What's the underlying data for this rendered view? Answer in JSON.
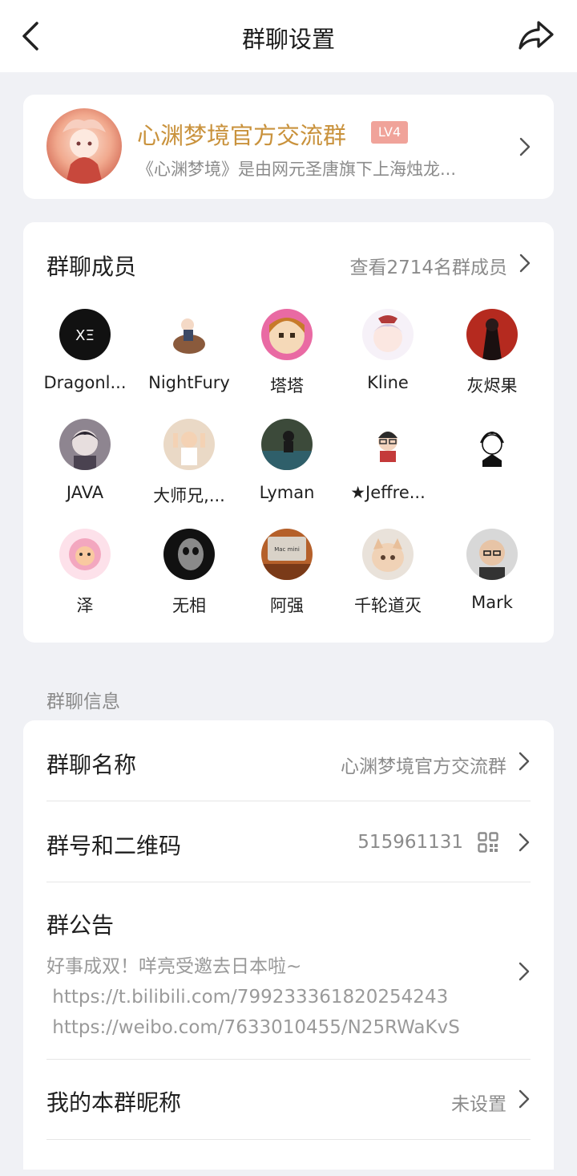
{
  "header": {
    "title": "群聊设置",
    "back_icon": "back-arrow-icon",
    "share_icon": "share-icon"
  },
  "group": {
    "name": "心渊梦境官方交流群",
    "level": "LV4",
    "description": "《心渊梦境》是由网元圣唐旗下上海烛龙..."
  },
  "members": {
    "title": "群聊成员",
    "view_all": "查看2714名群成员",
    "list": [
      {
        "name": "Dragonl...",
        "color": "#111111"
      },
      {
        "name": "NightFury",
        "color": "#f4ece6"
      },
      {
        "name": "塔塔",
        "color": "#e96aa3"
      },
      {
        "name": "Kline",
        "color": "#e9dff0"
      },
      {
        "name": "灰烬果",
        "color": "#b52a1f"
      },
      {
        "name": "JAVA",
        "color": "#5a5260"
      },
      {
        "name": "大师兄,...",
        "color": "#ead9c6"
      },
      {
        "name": "Lyman",
        "color": "#3c4a3a"
      },
      {
        "name": "★Jeffre...",
        "color": "#f2f2f2"
      },
      {
        "name": "",
        "color": "#ffffff"
      },
      {
        "name": "泽",
        "color": "#f6c1d0"
      },
      {
        "name": "无相",
        "color": "#1a1a1a"
      },
      {
        "name": "阿强",
        "color": "#b5602a"
      },
      {
        "name": "千轮道灭",
        "color": "#e6cdb8"
      },
      {
        "name": "Mark",
        "color": "#cfc4bb"
      }
    ]
  },
  "info": {
    "section_label": "群聊信息",
    "group_name_label": "群聊名称",
    "group_name_value": "心渊梦境官方交流群",
    "group_id_label": "群号和二维码",
    "group_id_value": "515961131",
    "notice_label": "群公告",
    "notice_lines": [
      "好事成双！咩亮受邀去日本啦~",
      " https://t.bilibili.com/799233361820254243",
      " https://weibo.com/7633010455/N25RWaKvS"
    ],
    "nickname_label": "我的本群昵称",
    "nickname_value": "未设置"
  },
  "colors": {
    "accent_gold": "#c9923c",
    "level_badge": "#f0a39a",
    "muted": "#8b8b8b"
  }
}
